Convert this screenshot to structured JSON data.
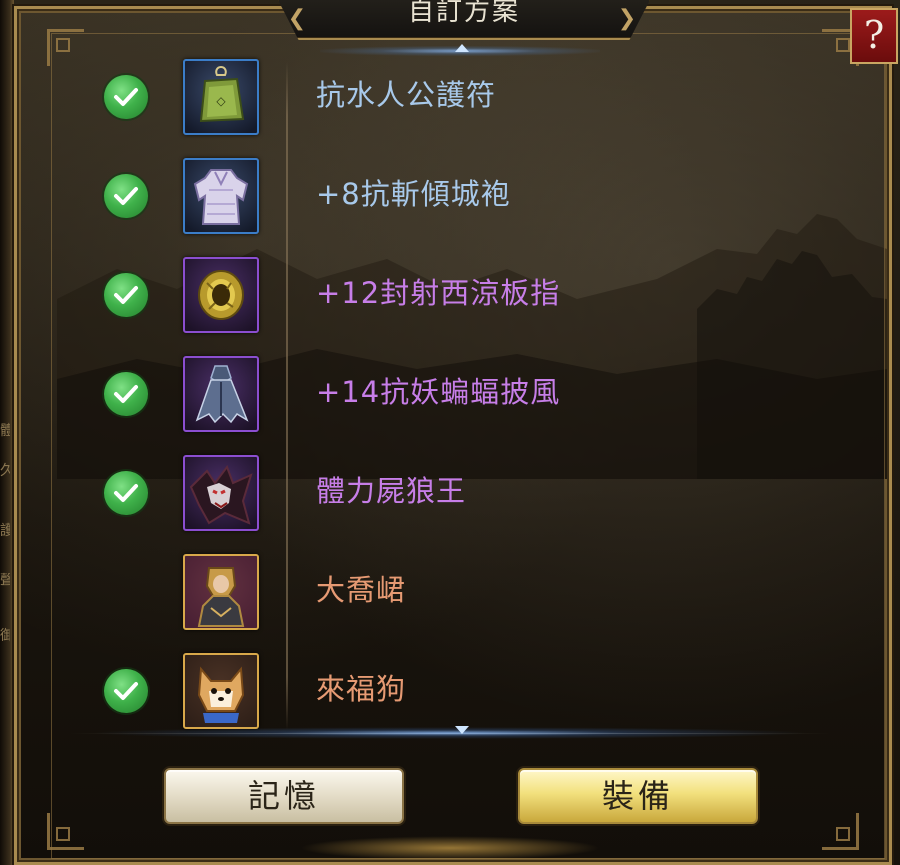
{
  "panel": {
    "title": "自訂方案",
    "help_label": "?"
  },
  "items": [
    {
      "name": "抗水人公護符",
      "checked": true,
      "rarity": "blue",
      "icon": "amulet-icon"
    },
    {
      "name": "+8抗斬傾城袍",
      "checked": true,
      "rarity": "blue",
      "icon": "robe-icon"
    },
    {
      "name": "+12封射西涼板指",
      "checked": true,
      "rarity": "purple",
      "icon": "ring-icon"
    },
    {
      "name": "+14抗妖蝙蝠披風",
      "checked": true,
      "rarity": "purple",
      "icon": "cape-icon"
    },
    {
      "name": "體力屍狼王",
      "checked": true,
      "rarity": "purple",
      "icon": "wolf-king-icon"
    },
    {
      "name": "大喬峮",
      "checked": false,
      "rarity": "orange",
      "icon": "general-portrait-icon"
    },
    {
      "name": "來福狗",
      "checked": true,
      "rarity": "orange",
      "icon": "dog-pet-icon"
    }
  ],
  "buttons": {
    "memory_label": "記憶",
    "equip_label": "裝備"
  },
  "colors": {
    "blue_text": "#a8c9ea",
    "purple_text": "#c77ee8",
    "orange_text": "#e69a73",
    "check_green": "#3fb14a",
    "frame_gold": "#a98b4f"
  }
}
